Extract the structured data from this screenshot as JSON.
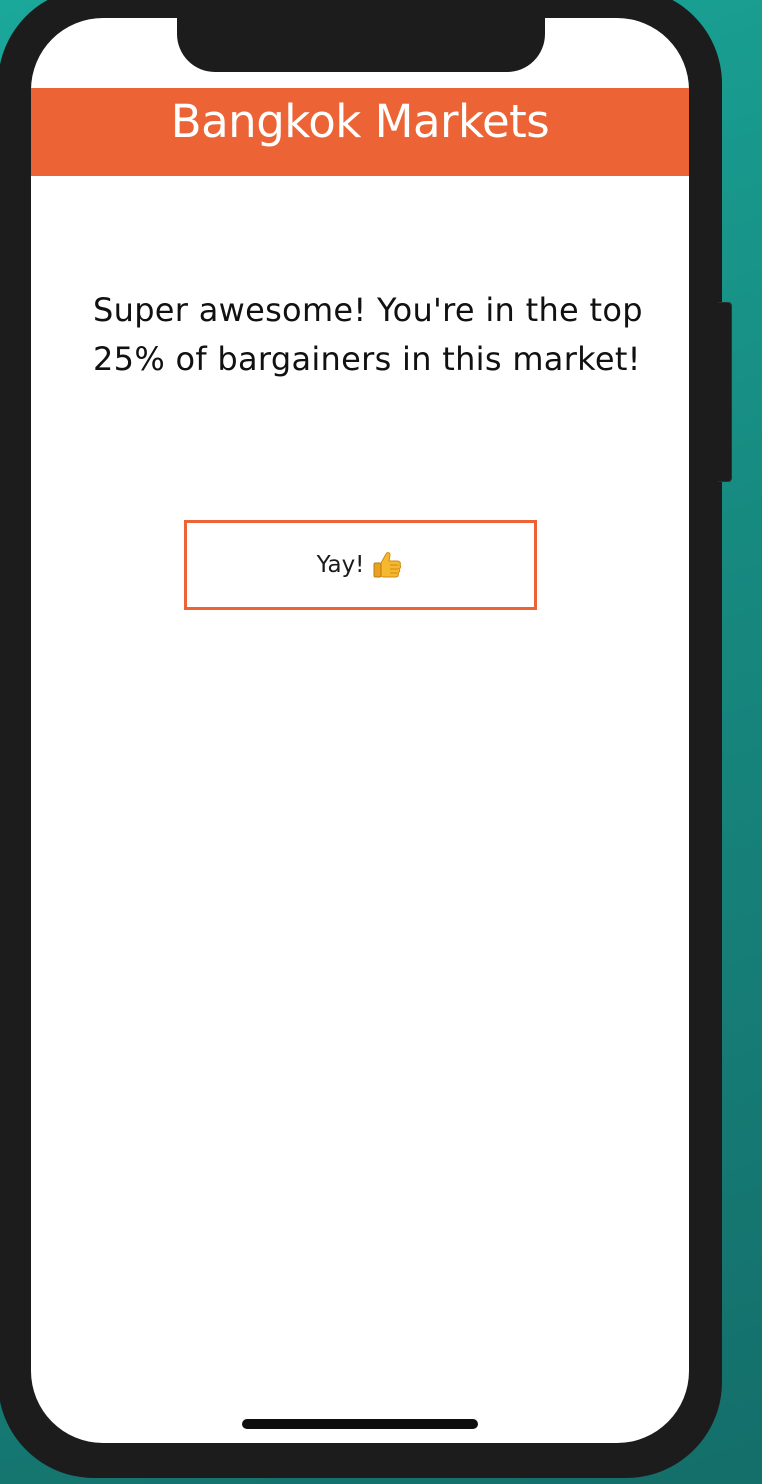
{
  "app": {
    "title": "Bangkok Markets"
  },
  "main": {
    "message": "Super awesome! You're in the top 25% of bargainers in this market!",
    "button": {
      "label": "Yay!",
      "icon": "thumbs-up-icon"
    }
  },
  "colors": {
    "accent": "#ec6436",
    "background_teal": "#178a80",
    "phone_frame": "#1c1c1c",
    "screen": "#ffffff",
    "thumb": "#f5b82e"
  }
}
